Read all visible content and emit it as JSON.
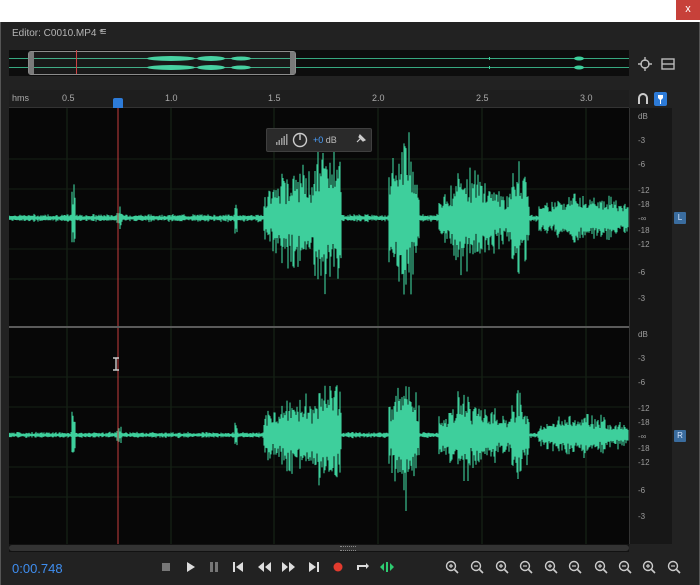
{
  "window": {
    "close_label": "x"
  },
  "panel": {
    "title": "Editor: C0010.MP4 *",
    "menu_icon": "hamburger-icon"
  },
  "ruler": {
    "unit": "hms",
    "ticks": [
      {
        "label": "0.5"
      },
      {
        "label": "1.0"
      },
      {
        "label": "1.5"
      },
      {
        "label": "2.0"
      },
      {
        "label": "2.5"
      },
      {
        "label": "3.0"
      }
    ]
  },
  "hud": {
    "value": "+0",
    "unit": "dB"
  },
  "channels": [
    {
      "badge": "L",
      "db_labels": [
        "dB",
        "-3",
        "-6",
        "-12",
        "-18",
        "-∞",
        "-18",
        "-12",
        "-6",
        "-3"
      ]
    },
    {
      "badge": "R",
      "db_labels": [
        "dB",
        "-3",
        "-6",
        "-12",
        "-18",
        "-∞",
        "-18",
        "-12",
        "-6",
        "-3"
      ]
    }
  ],
  "transport": {
    "time": "0:00.748",
    "buttons": [
      "stop-icon",
      "play-icon",
      "pause-icon",
      "go-to-start-icon",
      "rewind-icon",
      "fast-forward-icon",
      "go-to-end-icon",
      "record-icon",
      "loop-icon",
      "skip-selection-icon"
    ]
  },
  "zoom": {
    "buttons": [
      "zoom-in-amplitude-icon",
      "zoom-out-amplitude-icon",
      "zoom-in-time-icon",
      "zoom-out-time-icon",
      "zoom-out-full-icon",
      "zoom-in-left-icon",
      "zoom-in-right-icon",
      "zoom-selection-icon",
      "zoom-to-all-icon",
      "zoom-reset-icon"
    ]
  },
  "colors": {
    "waveform": "#3ecf9c",
    "accent": "#2d7bd8",
    "playhead": "#c43c3c"
  }
}
